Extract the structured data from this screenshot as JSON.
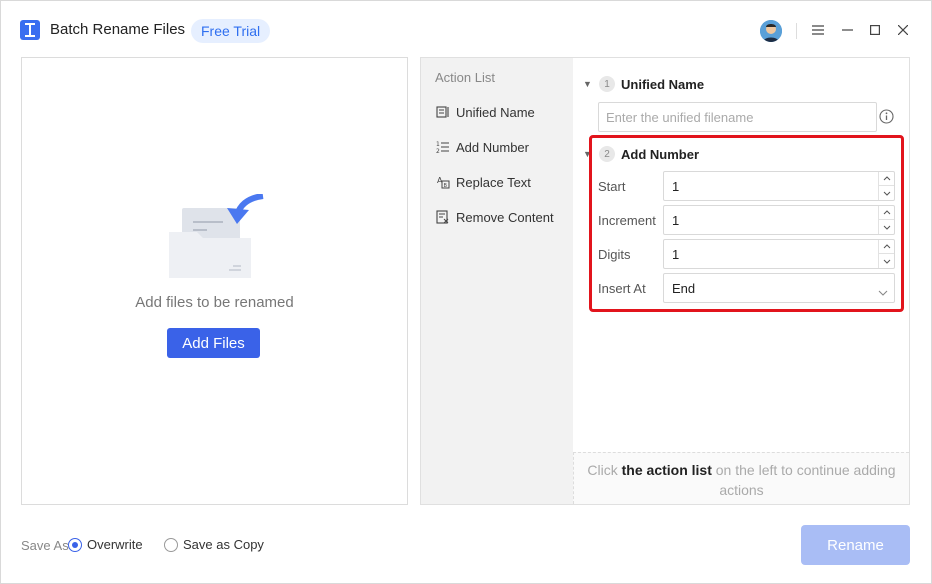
{
  "app": {
    "title": "Batch Rename Files",
    "trial_badge": "Free Trial"
  },
  "drop_area": {
    "message": "Add files to be renamed",
    "add_button": "Add Files"
  },
  "action_list": {
    "title": "Action List",
    "items": [
      {
        "label": "Unified Name",
        "icon": "unified-name-icon"
      },
      {
        "label": "Add Number",
        "icon": "add-number-icon"
      },
      {
        "label": "Replace Text",
        "icon": "replace-text-icon"
      },
      {
        "label": "Remove Content",
        "icon": "remove-content-icon"
      }
    ]
  },
  "config": {
    "unified_name": {
      "number": "1",
      "title": "Unified Name",
      "placeholder": "Enter the unified filename",
      "value": ""
    },
    "add_number": {
      "number": "2",
      "title": "Add Number",
      "fields": [
        {
          "label": "Start",
          "value": "1"
        },
        {
          "label": "Increment",
          "value": "1"
        },
        {
          "label": "Digits",
          "value": "1"
        }
      ],
      "insert_at": {
        "label": "Insert At",
        "value": "End"
      }
    },
    "hint": {
      "prefix": "Click ",
      "bold": "the action list",
      "suffix": " on the left to continue adding actions"
    }
  },
  "footer": {
    "save_as_label": "Save As",
    "options": [
      {
        "label": "Overwrite",
        "selected": true
      },
      {
        "label": "Save as Copy",
        "selected": false
      }
    ],
    "rename_button": "Rename"
  },
  "colors": {
    "accent": "#3a62e8",
    "highlight": "#e2141c",
    "badge_bg": "#e6efff",
    "rename_disabled": "#a9bdf5"
  }
}
